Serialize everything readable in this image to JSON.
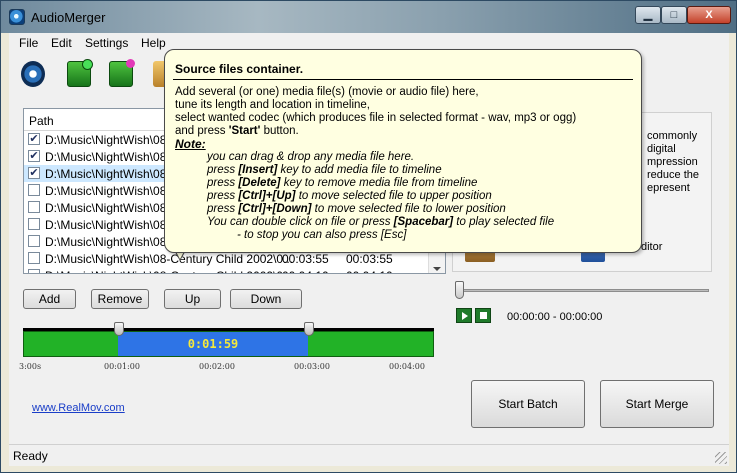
{
  "window": {
    "title": "AudioMerger",
    "min": "▁",
    "max": "□",
    "close": "X"
  },
  "menu": [
    "File",
    "Edit",
    "Settings",
    "Help"
  ],
  "list": {
    "header_path": "Path",
    "rows": [
      {
        "checked": true,
        "path": "D:\\Music\\NightWish\\08-C",
        "len": "",
        "end": ""
      },
      {
        "checked": true,
        "path": "D:\\Music\\NightWish\\08-C",
        "len": "",
        "end": ""
      },
      {
        "checked": true,
        "path": "D:\\Music\\NightWish\\08-C",
        "len": "",
        "end": ""
      },
      {
        "checked": false,
        "path": "D:\\Music\\NightWish\\08-C",
        "len": "",
        "end": ""
      },
      {
        "checked": false,
        "path": "D:\\Music\\NightWish\\08-C",
        "len": "",
        "end": ""
      },
      {
        "checked": false,
        "path": "D:\\Music\\NightWish\\08-C",
        "len": "",
        "end": ""
      },
      {
        "checked": false,
        "path": "D:\\Music\\NightWish\\08-C",
        "len": "",
        "end": ""
      },
      {
        "checked": false,
        "path": "D:\\Music\\NightWish\\08-Century Child 2002\\0...",
        "len": "00:03:55",
        "end": "00:03:55"
      },
      {
        "checked": false,
        "path": "D:\\Music\\NightWish\\08-Century Child 2002\\0...",
        "len": "00:04:10",
        "end": "00:04:10"
      }
    ]
  },
  "buttons": {
    "add": "Add",
    "remove": "Remove",
    "up": "Up",
    "down": "Down",
    "batch": "Start Batch",
    "merge": "Start Merge"
  },
  "timeline": {
    "selection_time": "0:01:59",
    "ticks": [
      "3:00s",
      "00:01:00",
      "00:02:00",
      "00:03:00",
      "00:04:00"
    ]
  },
  "link": "www.RealMov.com",
  "right_panel": {
    "lines": [
      "commonly",
      "digital",
      "mpression",
      "reduce the",
      "epresent"
    ],
    "editor": "ditor"
  },
  "player": {
    "time": "00:00:00 - 00:00:00"
  },
  "status": "Ready",
  "tooltip": {
    "title": "Source files container.",
    "lines": [
      "Add several (or one) media file(s) (movie or audio file) here,",
      "tune its length and location in timeline,",
      "select wanted codec (which produces file in selected format - wav, mp3 or ogg)"
    ],
    "start_line_pre": "and press ",
    "start_line_bold": "'Start'",
    "start_line_post": " button.",
    "note": "Note:",
    "note_lines": [
      {
        "pre": "you can drag & drop any media file here.",
        "key": "",
        "post": ""
      },
      {
        "pre": "press ",
        "key": "[Insert]",
        "post": " key to add media file to timeline"
      },
      {
        "pre": "press ",
        "key": "[Delete]",
        "post": " key to remove media file from timeline"
      },
      {
        "pre": "press ",
        "key": "[Ctrl]+[Up]",
        "post": " to move selected file to upper position"
      },
      {
        "pre": "press ",
        "key": "[Ctrl]+[Down]",
        "post": " to move selected file to lower position"
      },
      {
        "pre": "You can double click on file or press ",
        "key": "[Spacebar]",
        "post": " to play selected file"
      },
      {
        "pre": "- to stop you can also press [Esc]",
        "key": "",
        "post": ""
      }
    ]
  }
}
